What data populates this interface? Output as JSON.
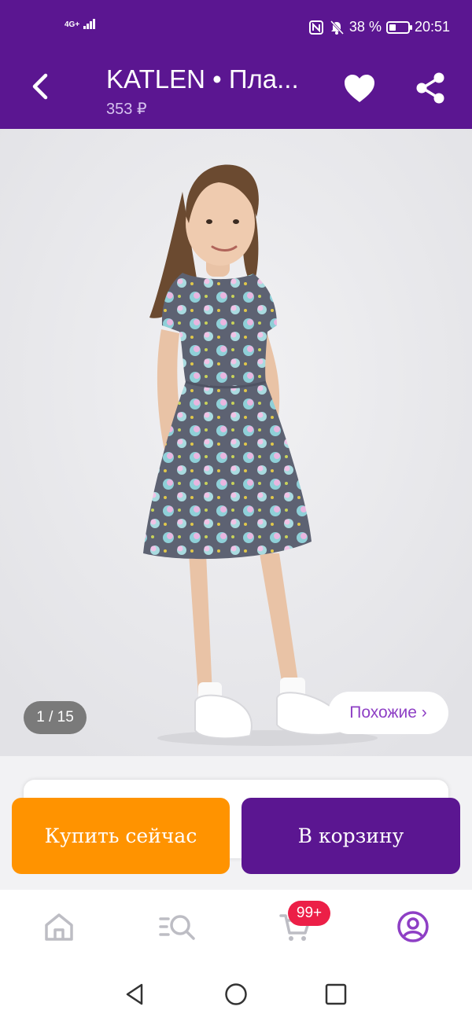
{
  "status_bar": {
    "network": "4G+",
    "battery_text": "38 %",
    "battery_level": 0.38,
    "time": "20:51",
    "icons": [
      "nfc-icon",
      "mute-bell-icon",
      "battery-icon",
      "signal-icon"
    ]
  },
  "app_bar": {
    "title": "KATLEN • Пла...",
    "price": "353 ₽",
    "icons": [
      "back-arrow-icon",
      "heart-icon",
      "share-icon"
    ]
  },
  "gallery": {
    "counter": "1 / 15",
    "similar_label": "Похожие ›"
  },
  "actions": {
    "buy_now": "Купить сейчас",
    "add_to_cart": "В корзину"
  },
  "bottom_nav": {
    "items": [
      "home-icon",
      "catalog-search-icon",
      "cart-icon",
      "profile-icon"
    ],
    "cart_badge": "99+",
    "active_color": "#8e3fc5",
    "inactive_color": "#bdbdc4"
  },
  "colors": {
    "brand": "#5b1691",
    "accent_orange": "#ff9300",
    "badge_red": "#ec1f47"
  }
}
